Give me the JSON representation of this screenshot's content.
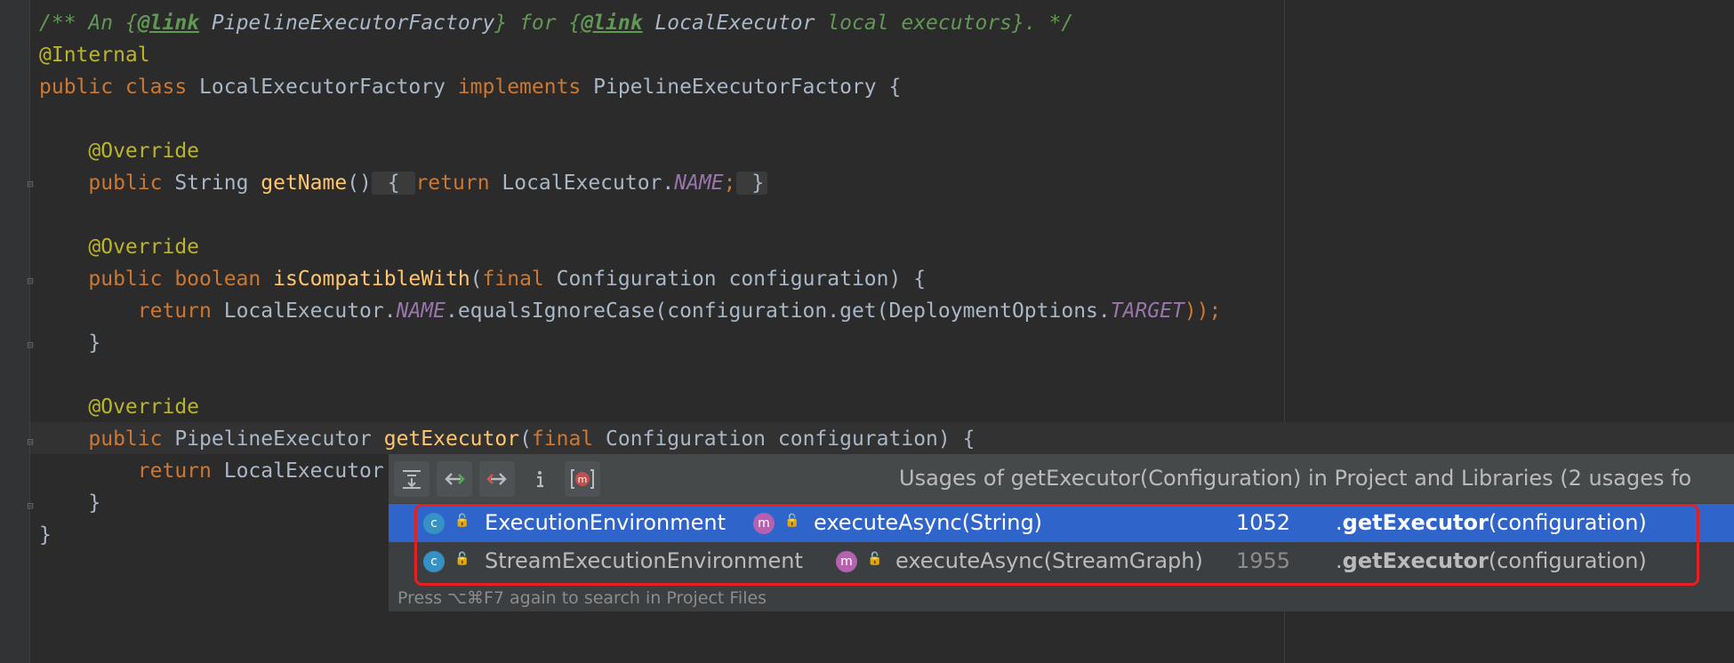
{
  "code": {
    "lines": [
      {
        "parts": [
          {
            "t": "/** An {",
            "c": "cm"
          },
          {
            "t": "@link",
            "c": "cm-tag"
          },
          {
            "t": " PipelineExecutorFactory",
            "c": "cm-ref"
          },
          {
            "t": "} for {",
            "c": "cm"
          },
          {
            "t": "@link",
            "c": "cm-tag"
          },
          {
            "t": " LocalExecutor",
            "c": "cm-ref"
          },
          {
            "t": " local executors}. */",
            "c": "cm"
          }
        ]
      },
      {
        "parts": [
          {
            "t": "@Internal",
            "c": "ann"
          }
        ]
      },
      {
        "parts": [
          {
            "t": "public class ",
            "c": "kw"
          },
          {
            "t": "LocalExecutorFactory ",
            "c": ""
          },
          {
            "t": "implements ",
            "c": "kw"
          },
          {
            "t": "PipelineExecutorFactory {",
            "c": ""
          }
        ]
      },
      {
        "parts": []
      },
      {
        "parts": [
          {
            "t": "    ",
            "c": ""
          },
          {
            "t": "@Override",
            "c": "ann"
          }
        ]
      },
      {
        "parts": [
          {
            "t": "    ",
            "c": ""
          },
          {
            "t": "public ",
            "c": "kw"
          },
          {
            "t": "String ",
            "c": ""
          },
          {
            "t": "getName",
            "c": "fn"
          },
          {
            "t": "()",
            "c": ""
          },
          {
            "t": " { ",
            "c": "fold-bg"
          },
          {
            "t": "return ",
            "c": "kw"
          },
          {
            "t": "LocalExecutor.",
            "c": ""
          },
          {
            "t": "NAME",
            "c": "st"
          },
          {
            "t": ";",
            "c": "kw"
          },
          {
            "t": " }",
            "c": "fold-bg"
          }
        ]
      },
      {
        "parts": []
      },
      {
        "parts": [
          {
            "t": "    ",
            "c": ""
          },
          {
            "t": "@Override",
            "c": "ann"
          }
        ]
      },
      {
        "parts": [
          {
            "t": "    ",
            "c": ""
          },
          {
            "t": "public boolean ",
            "c": "kw"
          },
          {
            "t": "isCompatibleWith",
            "c": "fn"
          },
          {
            "t": "(",
            "c": ""
          },
          {
            "t": "final ",
            "c": "kw"
          },
          {
            "t": "Configuration configuration) {",
            "c": ""
          }
        ]
      },
      {
        "parts": [
          {
            "t": "        ",
            "c": ""
          },
          {
            "t": "return ",
            "c": "kw"
          },
          {
            "t": "LocalExecutor.",
            "c": ""
          },
          {
            "t": "NAME",
            "c": "st"
          },
          {
            "t": ".equalsIgnoreCase(configuration.get(DeploymentOptions.",
            "c": ""
          },
          {
            "t": "TARGET",
            "c": "st"
          },
          {
            "t": "));",
            "c": "kw"
          }
        ]
      },
      {
        "parts": [
          {
            "t": "    }",
            "c": ""
          }
        ]
      },
      {
        "parts": []
      },
      {
        "parts": [
          {
            "t": "    ",
            "c": ""
          },
          {
            "t": "@Override",
            "c": "ann"
          }
        ]
      },
      {
        "parts": [
          {
            "t": "    ",
            "c": ""
          },
          {
            "t": "public ",
            "c": "kw"
          },
          {
            "t": "PipelineExecutor ",
            "c": ""
          },
          {
            "t": "getExecutor",
            "c": "fn"
          },
          {
            "t": "(",
            "c": ""
          },
          {
            "t": "final ",
            "c": "kw"
          },
          {
            "t": "Configuration configuration) {",
            "c": ""
          }
        ]
      },
      {
        "parts": [
          {
            "t": "        ",
            "c": ""
          },
          {
            "t": "return ",
            "c": "kw"
          },
          {
            "t": "LocalExecutor",
            "c": ""
          }
        ]
      },
      {
        "parts": [
          {
            "t": "    }",
            "c": ""
          }
        ]
      },
      {
        "parts": [
          {
            "t": "}",
            "c": ""
          }
        ]
      }
    ]
  },
  "popup": {
    "title": "Usages of getExecutor(Configuration) in Project and Libraries (2 usages fo",
    "toolbar": {
      "icons": [
        "expand-all-icon",
        "previous-usage-icon",
        "next-usage-icon",
        "info-icon",
        "method-filter-icon"
      ]
    },
    "rows": [
      {
        "class_name": "ExecutionEnvironment",
        "method": "executeAsync(String)",
        "line": "1052",
        "call_prefix": ".",
        "call_bold": "getExecutor",
        "call_suffix": "(configuration)",
        "selected": true
      },
      {
        "class_name": "StreamExecutionEnvironment",
        "method": "executeAsync(StreamGraph)",
        "line": "1955",
        "call_prefix": ".",
        "call_bold": "getExecutor",
        "call_suffix": "(configuration)",
        "selected": false
      }
    ],
    "footer": "Press ⌥⌘F7 again to search in Project Files"
  },
  "colors": {
    "selection": "#2f65ca",
    "highlight_box": "#e62020",
    "class_icon": "#3592c4",
    "method_icon": "#b660b0"
  }
}
